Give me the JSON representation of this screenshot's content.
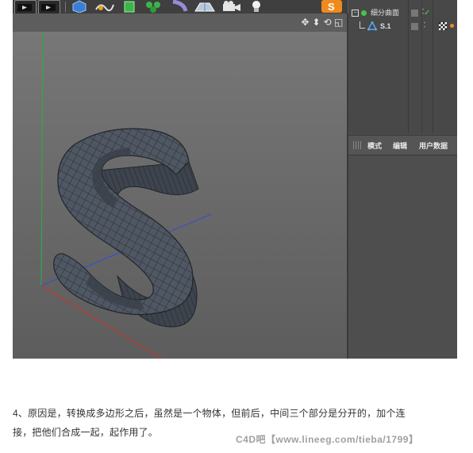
{
  "viewport": {
    "nav_icons": [
      "move-icon",
      "zoom-icon",
      "rotate-icon",
      "maximize-icon"
    ],
    "nav_glyphs": [
      "✥",
      "⬍",
      "⟲",
      "◱"
    ]
  },
  "object_manager": {
    "items": [
      {
        "label": "细分曲面",
        "icon": "subdivision-surface-icon",
        "color": "#4cc24c"
      },
      {
        "label": "S.1",
        "icon": "polygon-object-icon",
        "color": "#3a8ad8"
      }
    ]
  },
  "attribute_manager": {
    "tabs": [
      "模式",
      "编辑",
      "用户数据"
    ]
  },
  "caption": {
    "line1": "4、原因是，转换成多边形之后，虽然是一个物体，但前后，中间三个部分是分开的，加个连",
    "line2": "接，把他们合成一起，起作用了。"
  },
  "watermark": "C4D吧【www.lineeg.com/tieba/1799】",
  "colors": {
    "toolbar_bg": "#3f3f3f",
    "viewport_top": "#777777",
    "viewport_bottom": "#5d5d5d",
    "panel_bg": "#4b4b4b",
    "accent_orange": "#f08a1e",
    "mesh_fill": "#505864"
  }
}
